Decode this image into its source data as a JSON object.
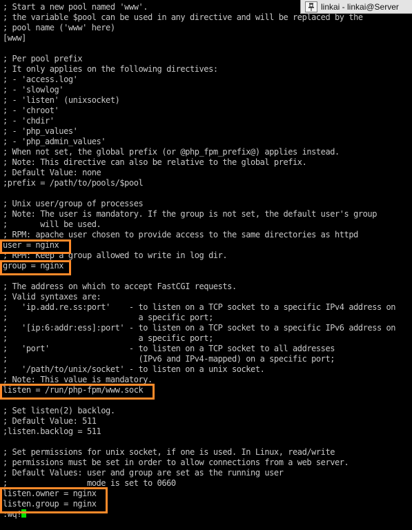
{
  "window": {
    "title": "linkai - linkai@Server"
  },
  "terminal": {
    "lines": [
      "; Start a new pool named 'www'.",
      "; the variable $pool can be used in any directive and will be replaced by the",
      "; pool name ('www' here)",
      "[www]",
      "",
      "; Per pool prefix",
      "; It only applies on the following directives:",
      "; - 'access.log'",
      "; - 'slowlog'",
      "; - 'listen' (unixsocket)",
      "; - 'chroot'",
      "; - 'chdir'",
      "; - 'php_values'",
      "; - 'php_admin_values'",
      "; When not set, the global prefix (or @php_fpm_prefix@) applies instead.",
      "; Note: This directive can also be relative to the global prefix.",
      "; Default Value: none",
      ";prefix = /path/to/pools/$pool",
      "",
      "; Unix user/group of processes",
      "; Note: The user is mandatory. If the group is not set, the default user's group",
      ";       will be used.",
      "; RPM: apache user chosen to provide access to the same directories as httpd",
      "user = nginx",
      "; RPM: Keep a group allowed to write in log dir.",
      "group = nginx",
      "",
      "; The address on which to accept FastCGI requests.",
      "; Valid syntaxes are:",
      ";   'ip.add.re.ss:port'    - to listen on a TCP socket to a specific IPv4 address on",
      ";                            a specific port;",
      ";   '[ip:6:addr:ess]:port' - to listen on a TCP socket to a specific IPv6 address on",
      ";                            a specific port;",
      ";   'port'                 - to listen on a TCP socket to all addresses",
      ";                            (IPv6 and IPv4-mapped) on a specific port;",
      ";   '/path/to/unix/socket' - to listen on a unix socket.",
      "; Note: This value is mandatory.",
      "listen = /run/php-fpm/www.sock",
      "",
      "; Set listen(2) backlog.",
      "; Default Value: 511",
      ";listen.backlog = 511",
      "",
      "; Set permissions for unix socket, if one is used. In Linux, read/write",
      "; permissions must be set in order to allow connections from a web server.",
      "; Default Values: user and group are set as the running user",
      ";                 mode is set to 0660",
      "listen.owner = nginx",
      "listen.group = nginx"
    ],
    "command_line": ":wq!"
  },
  "colors": {
    "background": "#000000",
    "text": "#c8c8c8",
    "cursor": "#00e000",
    "highlight": "#ff8a2a"
  },
  "icons": {
    "pin": "pin-icon"
  }
}
